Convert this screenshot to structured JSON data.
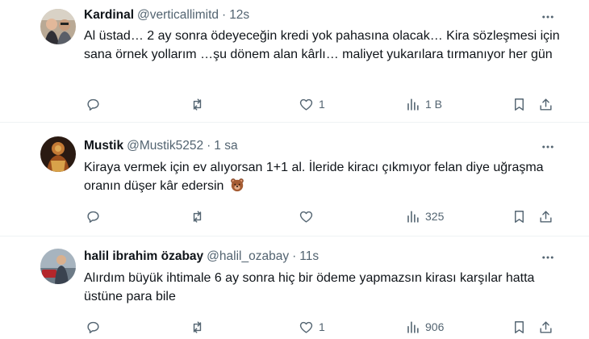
{
  "tweets": [
    {
      "name": "Kardinal",
      "handle": "@verticallimitd",
      "separator": "·",
      "time": "12s",
      "text": "Al üstad… 2 ay sonra ödeyeceğin kredi yok pahasına olacak… Kira sözleşmesi için sana örnek yollarım …şu dönem alan kârlı… maliyet yukarılara tırmanıyor her gün",
      "replies": "",
      "retweets": "",
      "likes": "1",
      "views": "1 B",
      "has_emoji": false,
      "emoji_icon": ""
    },
    {
      "name": "Mustik",
      "handle": "@Mustik5252",
      "separator": "·",
      "time": "1 sa",
      "text": "Kiraya vermek için ev alıyorsan 1+1 al. İleride kiracı çıkmıyor felan diye uğraşma oranın düşer kâr edersin",
      "replies": "",
      "retweets": "",
      "likes": "",
      "views": "325",
      "has_emoji": true,
      "emoji_icon": "bear-face-icon"
    },
    {
      "name": "halil ibrahim özabay",
      "handle": "@halil_ozabay",
      "separator": "·",
      "time": "11s",
      "text": "Alırdım büyük ihtimale 6 ay sonra hiç bir ödeme yapmazsın kirası karşılar hatta üstüne para bile",
      "replies": "",
      "retweets": "",
      "likes": "1",
      "views": "906",
      "has_emoji": false,
      "emoji_icon": ""
    }
  ],
  "icons": {
    "reply": "reply-icon",
    "retweet": "retweet-icon",
    "like": "heart-icon",
    "views": "views-icon",
    "bookmark": "bookmark-icon",
    "share": "share-icon",
    "more": "more-icon"
  },
  "colors": {
    "text": "#0f1419",
    "secondary": "#536471",
    "divider": "#eff3f4"
  }
}
